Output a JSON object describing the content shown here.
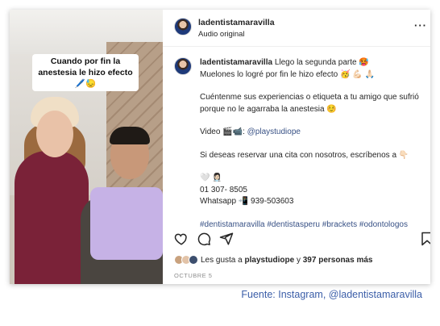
{
  "photo": {
    "caption": "Cuando por fin la anestesia le hizo efecto 🖊️😓"
  },
  "header": {
    "username": "ladentistamaravilla",
    "audio": "Audio original",
    "more_icon": "more-horizontal-icon"
  },
  "post": {
    "username": "ladentistamaravilla",
    "line1": "Llego la segunda parte 🥵",
    "line2": "Muelones lo logré por fin le hizo efecto 🥳 💪🏻 🙏🏻",
    "paragraph2": "Cuéntenme sus experiencias o etiqueta a tu amigo que sufrió porque no le agarraba la anestesia ☺️",
    "video_prefix": "Video 🎬📹:",
    "video_link": "@playstudiope",
    "booking": "Si deseas reservar una cita con nosotros, escríbenos a 👇🏻",
    "contact_emojis": "🤍 👩🏻‍⚕️",
    "phone": "01 307- 8505",
    "whatsapp": "Whatsapp 📲 939-503603",
    "hashtags": "#dentistamaravilla #dentistasperu #brackets #odontologos #limaperu🇵🇪 #surcolima #brackets #bracketsmetalicos #gingitivis"
  },
  "actions": {
    "like_icon": "heart-icon",
    "comment_icon": "comment-icon",
    "share_icon": "share-icon",
    "save_icon": "bookmark-icon"
  },
  "likes": {
    "prefix": "Les gusta a",
    "user": "playstudiope",
    "middle": "y",
    "count": "397 personas más"
  },
  "date": "OCTUBRE 5",
  "source": "Fuente: Instagram, @ladentistamaravilla",
  "colors": {
    "link": "#385185",
    "source": "#3b5ea8",
    "scrub_wine": "#7a2238",
    "bib_lilac": "#c6b2e6"
  }
}
